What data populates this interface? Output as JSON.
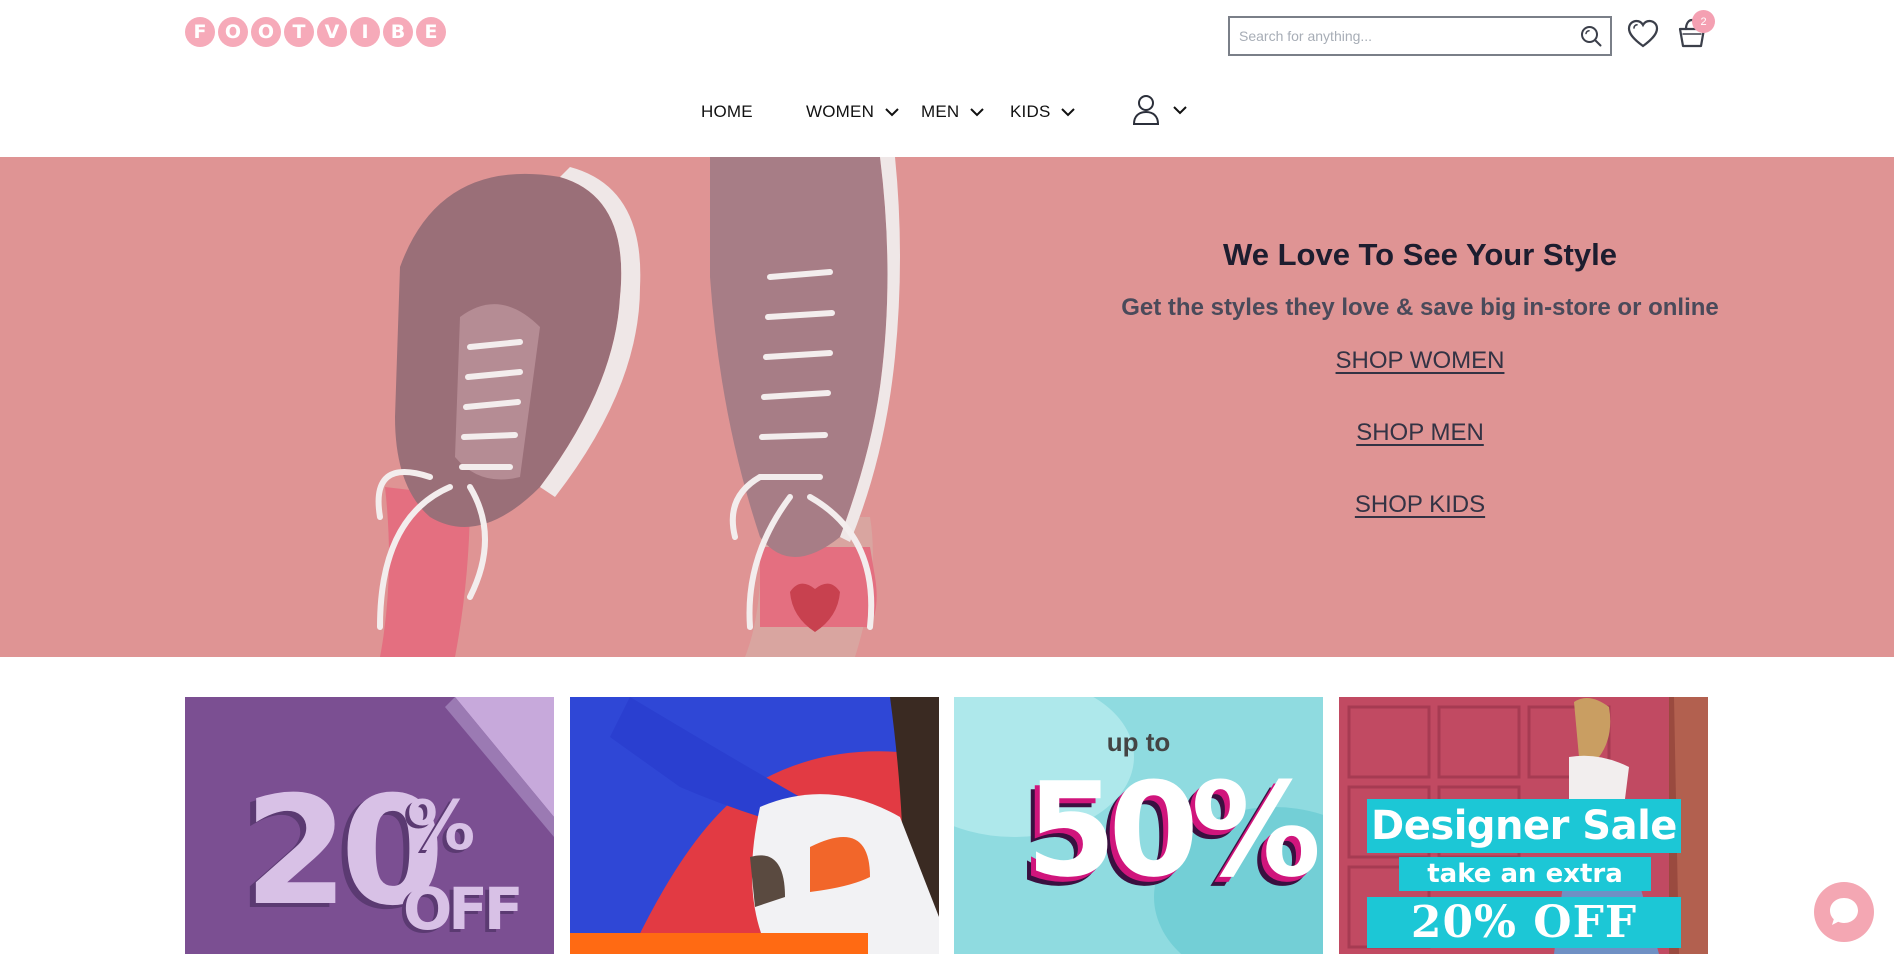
{
  "brand": {
    "letters": [
      "F",
      "O",
      "O",
      "T",
      "V",
      "I",
      "B",
      "E"
    ],
    "color": "#f6aab9"
  },
  "search": {
    "placeholder": "Search for anything...",
    "icon": "search-icon"
  },
  "header_icons": {
    "wishlist": "heart-icon",
    "cart": "cart-icon",
    "cart_count": "2"
  },
  "nav": {
    "home": "HOME",
    "women": "WOMEN",
    "men": "MEN",
    "kids": "KIDS",
    "account_icon": "user-icon",
    "dropdown_icon": "chevron-down-icon"
  },
  "hero": {
    "title": "We Love To See Your Style",
    "subtitle": "Get the styles they love & save big in-store or online",
    "links": {
      "women": "SHOP WOMEN",
      "men": "SHOP MEN",
      "kids": "SHOP KIDS"
    },
    "background": "#df9494"
  },
  "promos": {
    "tile1": {
      "big": "20",
      "pct": "%",
      "off": "OFF"
    },
    "tile3": {
      "upto": "up to",
      "big": "50%"
    },
    "tile4": {
      "title": "Designer Sale",
      "sub": "take an extra",
      "off": "20% OFF"
    }
  },
  "chat": {
    "icon": "chat-icon"
  }
}
